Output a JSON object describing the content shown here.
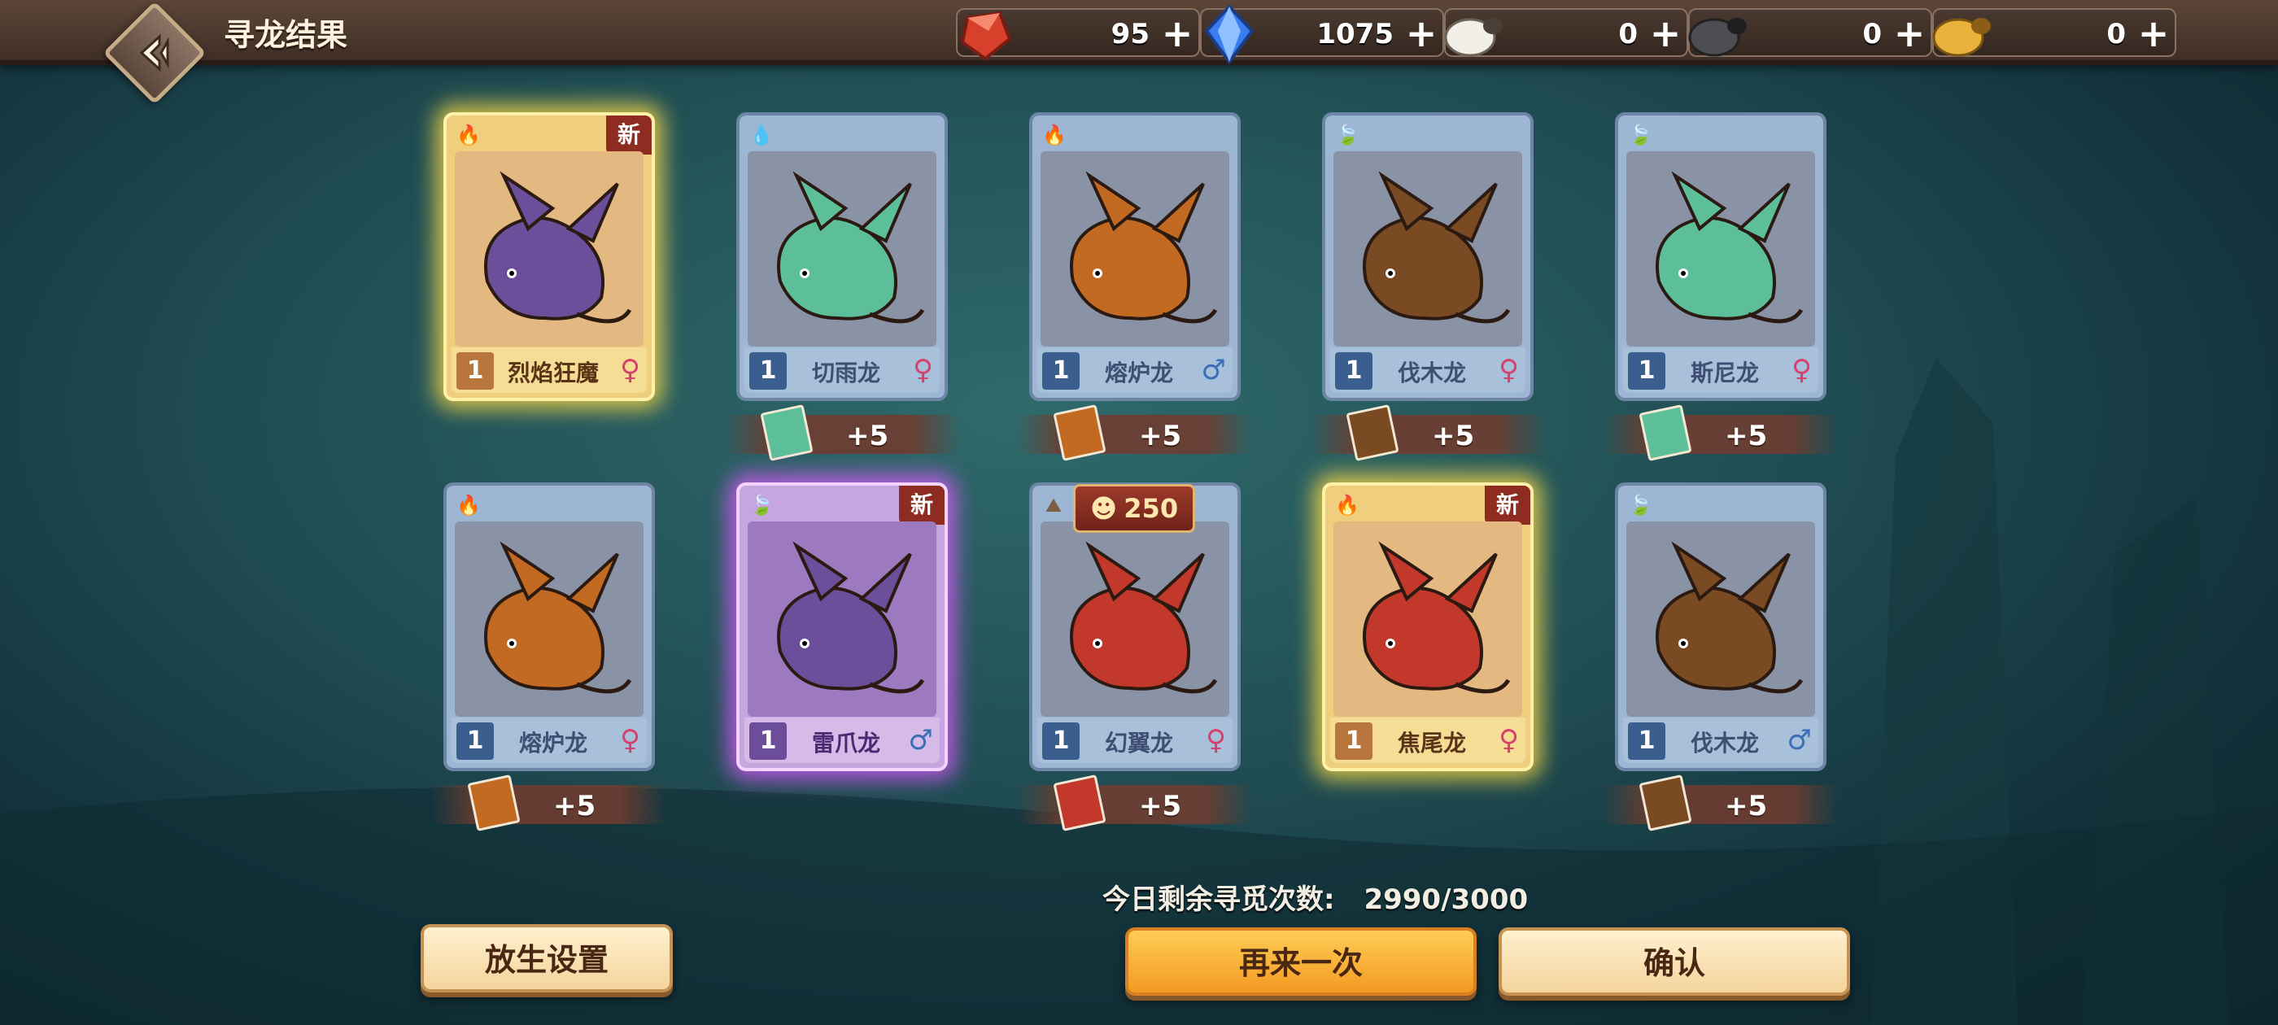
{
  "header": {
    "title": "寻龙结果",
    "resources": [
      {
        "icon": "red-gem-icon",
        "value": "95",
        "plus": "+"
      },
      {
        "icon": "blue-crystal-icon",
        "value": "1075",
        "plus": "+"
      },
      {
        "icon": "white-sheep-icon",
        "value": "0",
        "plus": "+"
      },
      {
        "icon": "black-sheep-icon",
        "value": "0",
        "plus": "+"
      },
      {
        "icon": "golden-sheep-icon",
        "value": "0",
        "plus": "+"
      }
    ]
  },
  "cards": [
    {
      "name": "烈焰狂魔",
      "level": "1",
      "gender": "♀",
      "element": "fire",
      "rarity": "gold",
      "new_tag": "新",
      "reward": ""
    },
    {
      "name": "切雨龙",
      "level": "1",
      "gender": "♀",
      "element": "water",
      "rarity": "normal",
      "new_tag": "",
      "reward": "+5"
    },
    {
      "name": "熔炉龙",
      "level": "1",
      "gender": "♂",
      "element": "fire",
      "rarity": "normal",
      "new_tag": "",
      "reward": "+5"
    },
    {
      "name": "伐木龙",
      "level": "1",
      "gender": "♀",
      "element": "nature",
      "rarity": "normal",
      "new_tag": "",
      "reward": "+5"
    },
    {
      "name": "斯尼龙",
      "level": "1",
      "gender": "♀",
      "element": "nature",
      "rarity": "normal",
      "new_tag": "",
      "reward": "+5"
    },
    {
      "name": "熔炉龙",
      "level": "1",
      "gender": "♀",
      "element": "fire",
      "rarity": "normal",
      "new_tag": "",
      "reward": "+5"
    },
    {
      "name": "雷爪龙",
      "level": "1",
      "gender": "♂",
      "element": "nature",
      "rarity": "purple",
      "new_tag": "新",
      "reward": ""
    },
    {
      "name": "幻翼龙",
      "level": "1",
      "gender": "♀",
      "element": "earth",
      "rarity": "normal",
      "new_tag": "",
      "reward": "+5",
      "badge": "250"
    },
    {
      "name": "焦尾龙",
      "level": "1",
      "gender": "♀",
      "element": "fire",
      "rarity": "gold",
      "new_tag": "新",
      "reward": ""
    },
    {
      "name": "伐木龙",
      "level": "1",
      "gender": "♂",
      "element": "nature",
      "rarity": "normal",
      "new_tag": "",
      "reward": "+5"
    }
  ],
  "footer": {
    "remaining_label": "今日剩余寻觅次数:",
    "remaining_value": "2990/3000",
    "release_settings_button": "放生设置",
    "again_button": "再来一次",
    "confirm_button": "确认"
  },
  "colors": {
    "fire": "#d8382b",
    "water": "#2e78c8",
    "nature": "#4e9a3a",
    "earth": "#7a5f45",
    "dragon_orange": "#c26a22",
    "dragon_green": "#5cbf99",
    "dragon_brown": "#7a4a22",
    "dragon_purple": "#6b4f9a",
    "dragon_red": "#c2382b"
  }
}
